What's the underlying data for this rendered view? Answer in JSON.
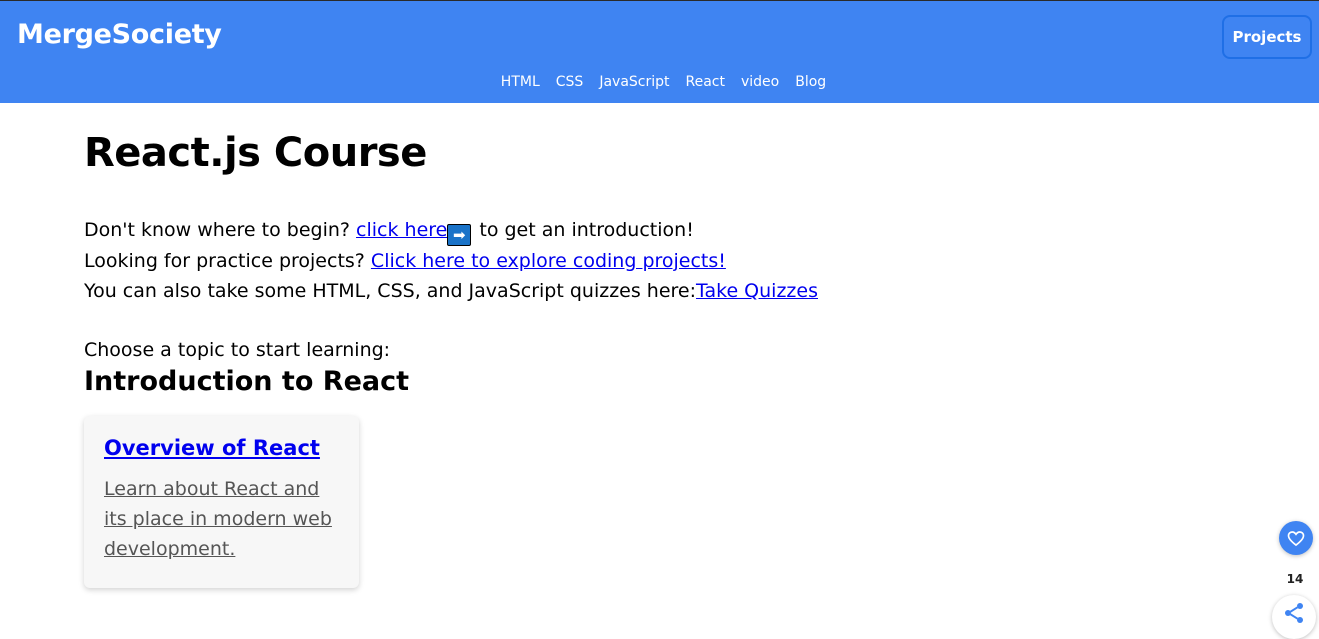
{
  "header": {
    "brand": "MergeSociety",
    "projects_button": "Projects",
    "nav": [
      "HTML",
      "CSS",
      "JavaScript",
      "React",
      "video",
      "Blog"
    ]
  },
  "main": {
    "title": "React.js Course",
    "line1_prefix": "Don't know where to begin? ",
    "line1_link": "click here",
    "line1_suffix": " to get an introduction!",
    "line2_prefix": "Looking for practice projects? ",
    "line2_link": "Click here to explore coding projects!",
    "line3_prefix": "You can also take some HTML, CSS, and JavaScript quizzes here:",
    "line3_link": "Take Quizzes",
    "choose_text": "Choose a topic to start learning:",
    "section_title": "Introduction to React",
    "card": {
      "title": "Overview of React",
      "description": "Learn about React and its place in modern web development."
    }
  },
  "floating": {
    "like_count": "14",
    "like_icon": "heart-icon",
    "share_icon": "share-icon"
  },
  "colors": {
    "header_bg": "#3f84f2",
    "link": "#0000ee"
  }
}
